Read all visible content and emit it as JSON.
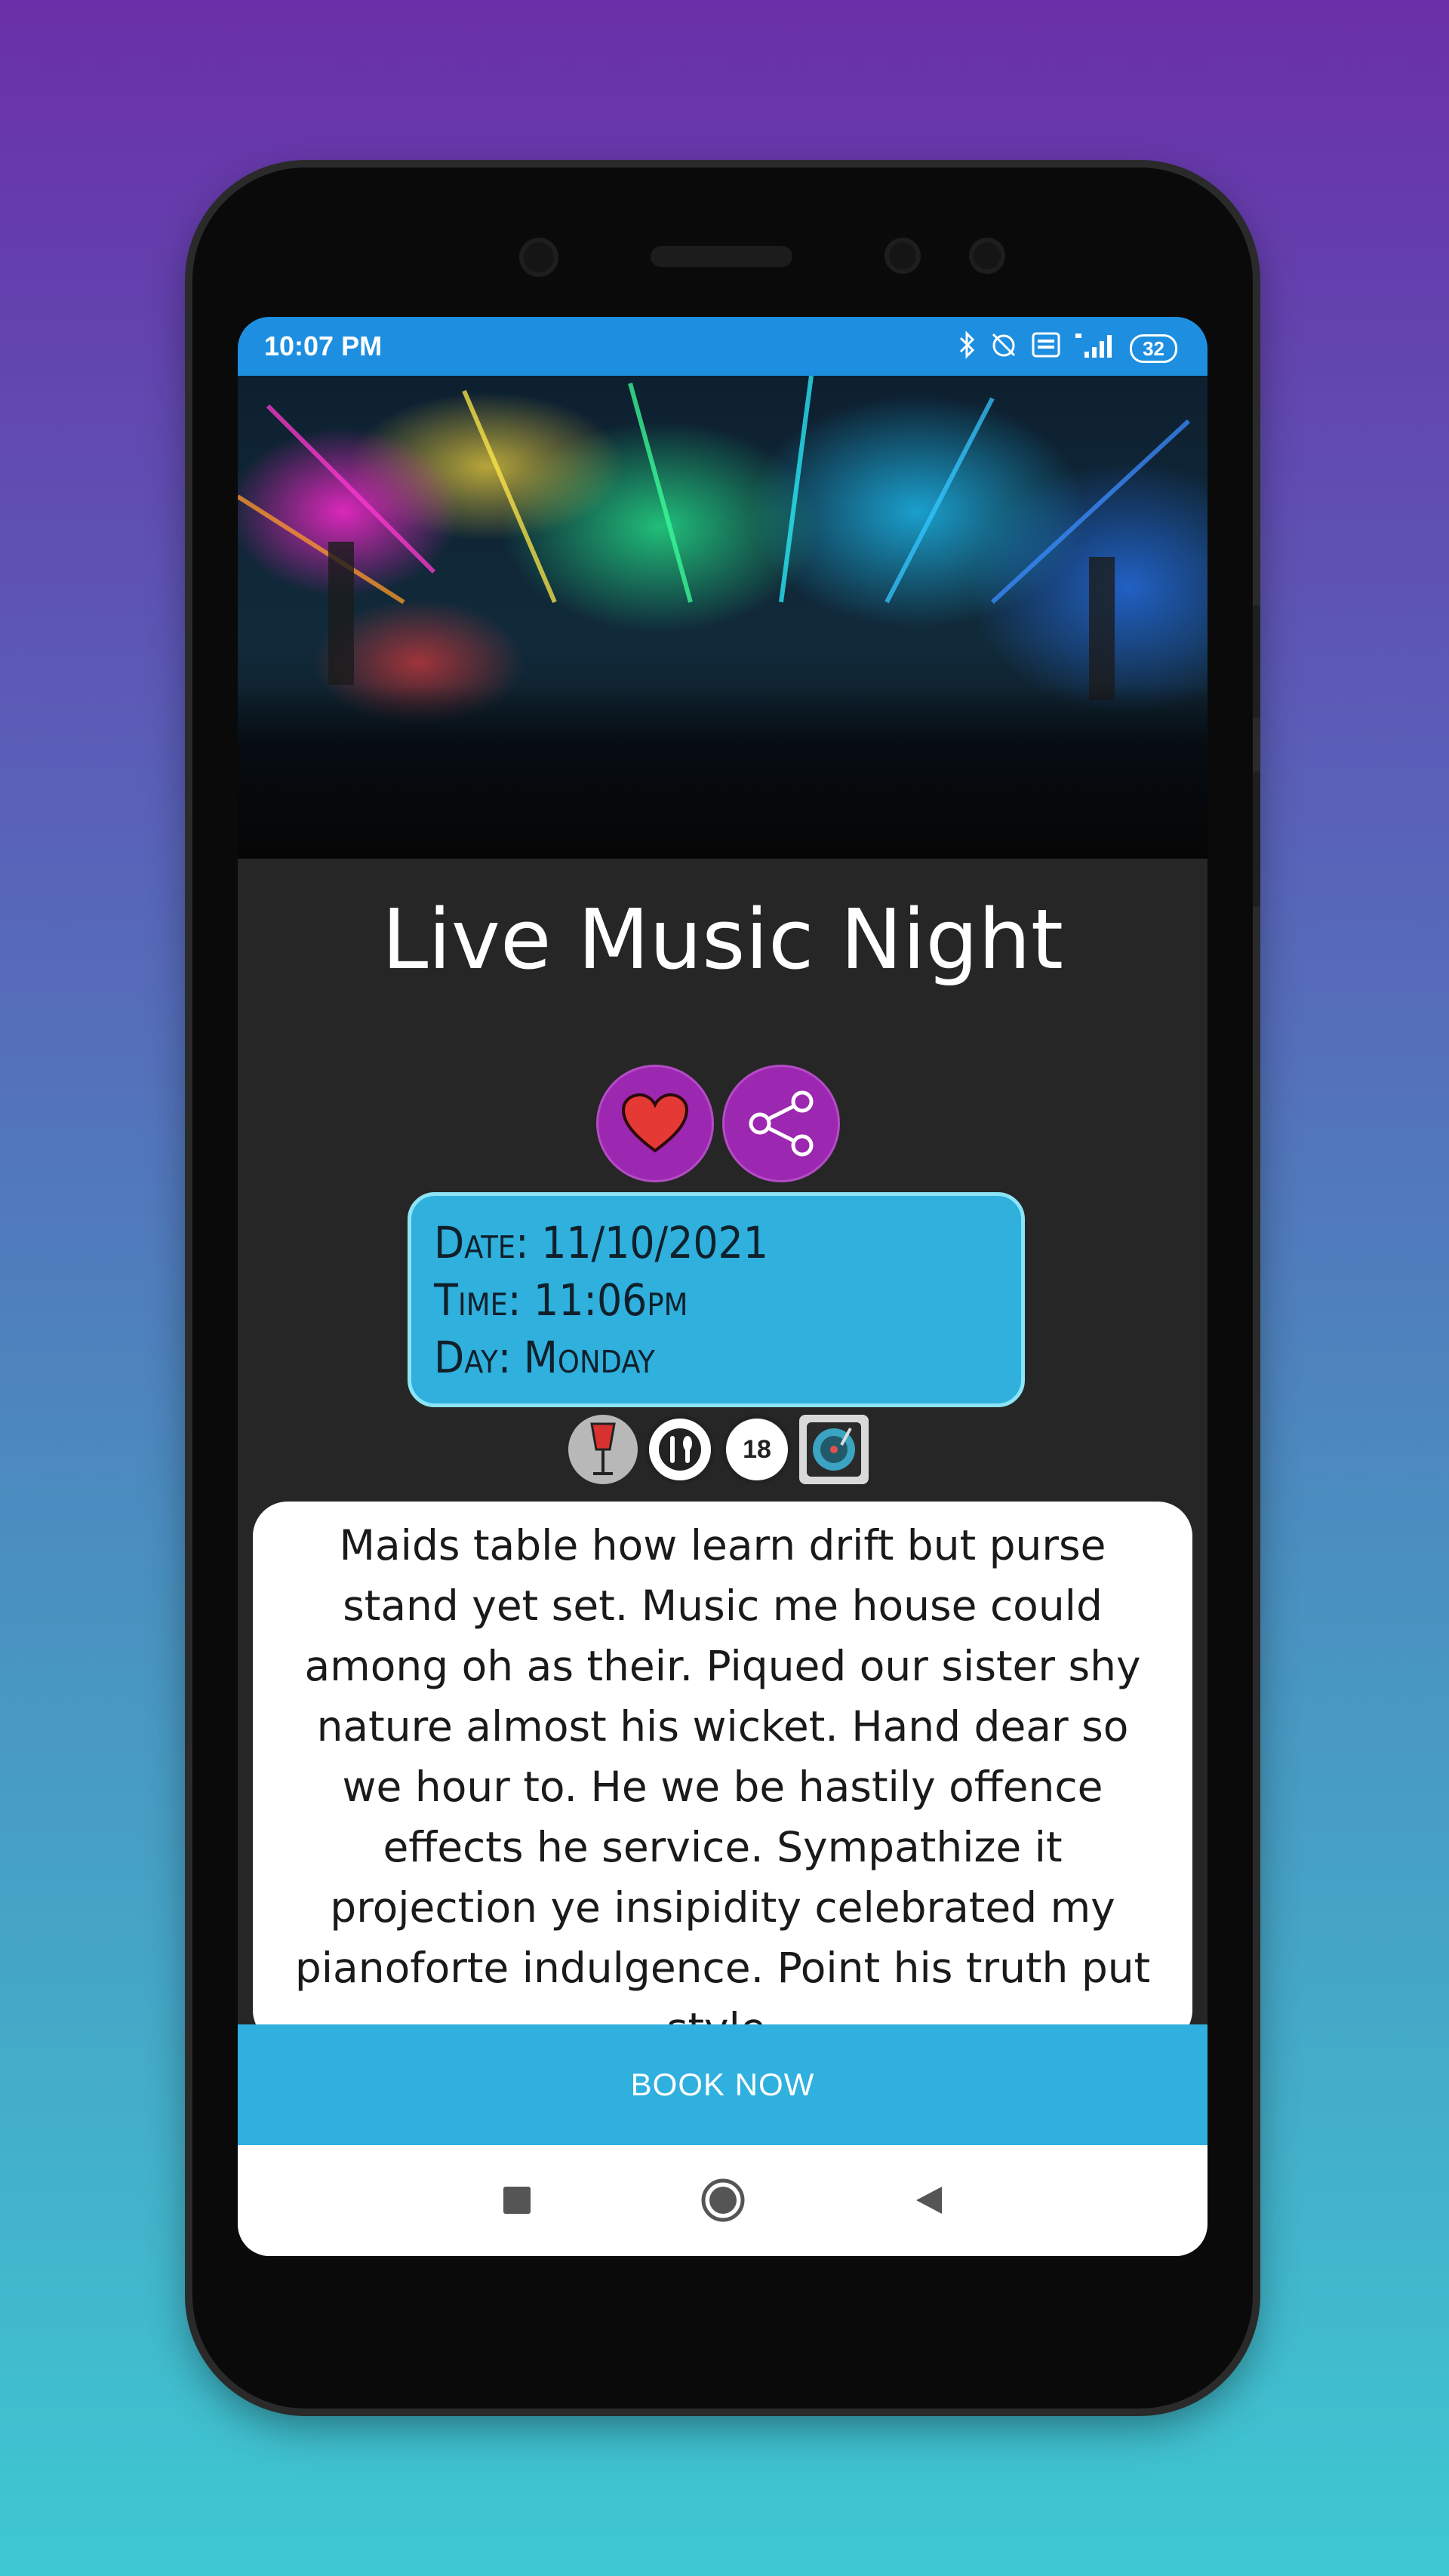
{
  "status_bar": {
    "time": "10:07 PM",
    "battery": "32",
    "icons": [
      "bluetooth-icon",
      "alarm-off-icon",
      "volte-icon",
      "signal-4g-icon",
      "battery-icon"
    ]
  },
  "event": {
    "title": "Live Music Night",
    "actions": [
      "heart-icon",
      "share-icon"
    ]
  },
  "schedule": {
    "date_line": "Date: 11/10/2021",
    "time_line": "Time: 11:06pm",
    "day_line": "Day: Monday"
  },
  "amenities": [
    "drinks-icon",
    "dining-icon",
    "age-18-plus-icon",
    "dj-turntable-icon"
  ],
  "description": "Maids table how learn drift but purse stand yet set. Music me house could among oh as their. Piqued our sister shy nature almost his wicket. Hand dear so we hour to. He we be hastily offence effects he service. Sympathize it projection ye insipidity celebrated my pianoforte indulgence. Point his truth put style.",
  "actions": {
    "book_label": "BOOK NOW"
  },
  "colors": {
    "accent_blue": "#2fb0df",
    "status_blue": "#1e8fe0",
    "purple": "#9c27b0",
    "heart_red": "#e53935"
  },
  "nav": [
    "recents-square-icon",
    "home-circle-icon",
    "back-triangle-icon"
  ]
}
